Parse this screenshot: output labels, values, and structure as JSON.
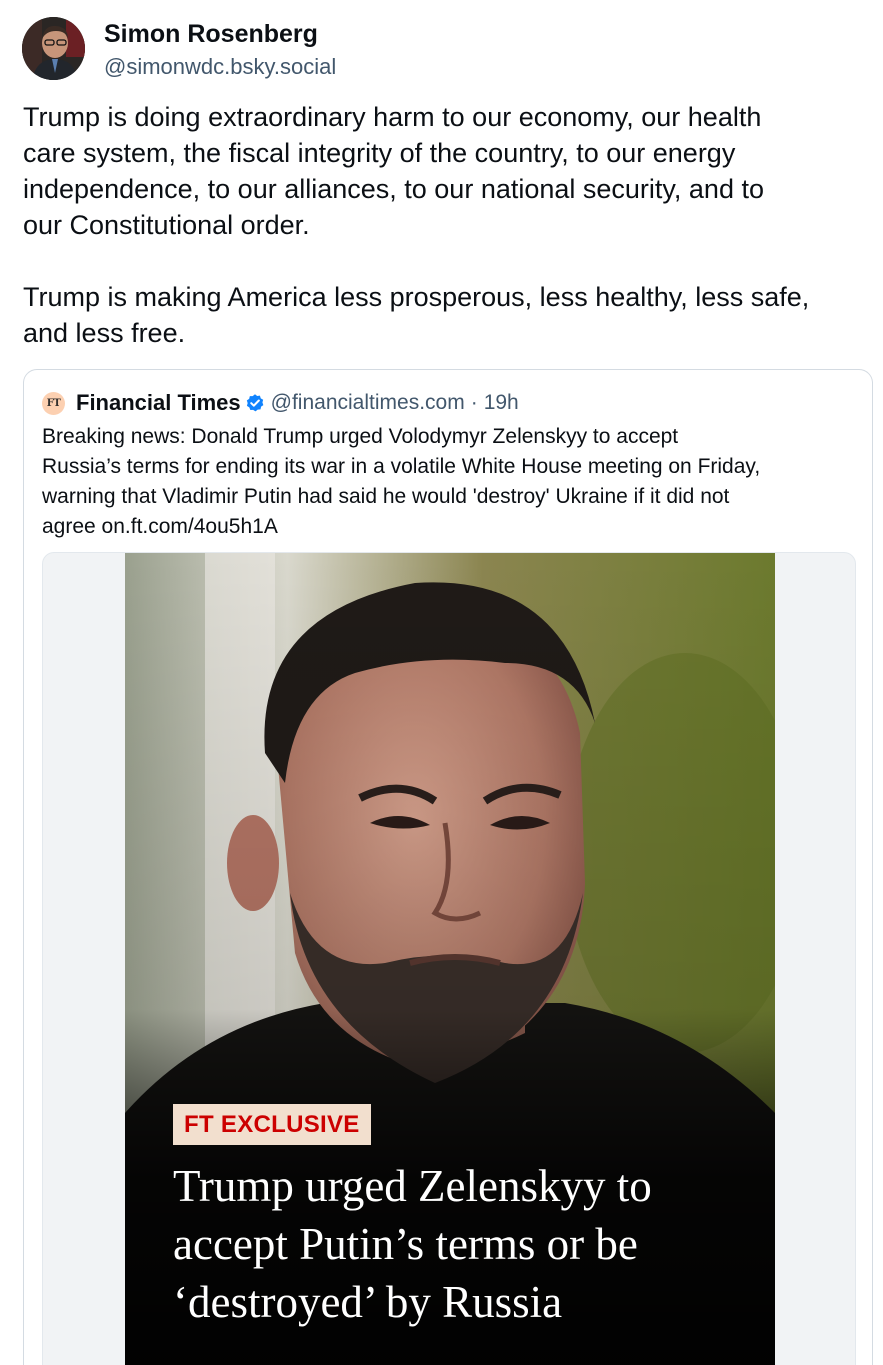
{
  "post": {
    "author_name": "Simon Rosenberg",
    "author_handle": "@simonwdc.bsky.social",
    "avatar_icon": "user-avatar-photo",
    "paragraphs": [
      "Trump is doing extraordinary harm to our economy, our health\ncare system, the fiscal integrity of the country, to our energy\nindependence, to our alliances, to our national security, and to\nour Constitutional order.",
      "Trump is making America less prosperous, less healthy, less safe,\nand less free."
    ]
  },
  "quote": {
    "avatar_text": "FT",
    "author_name": "Financial Times",
    "verified_icon": "verified-check-icon",
    "author_handle": "@financialtimes.com",
    "separator": "·",
    "time": "19h",
    "text": "Breaking news: Donald Trump urged Volodymyr Zelenskyy to accept\nRussia’s terms for ending its war in a volatile White House meeting on Friday,\nwarning that Vladimir Putin had said he would 'destroy' Ukraine if it did not\nagree on.ft.com/4ou5h1A",
    "media": {
      "badge": "FT EXCLUSIVE",
      "headline": "Trump urged Zelenskyy to\naccept Putin’s terms or be\n‘destroyed’ by Russia"
    }
  },
  "colors": {
    "text_primary": "#0b0f14",
    "text_secondary": "#42576c",
    "verified_blue": "#1083fe",
    "ft_pink": "#fcd0b1",
    "ft_red": "#cc0000",
    "badge_bg": "#f2dfce",
    "card_border": "#d4dbe2"
  }
}
